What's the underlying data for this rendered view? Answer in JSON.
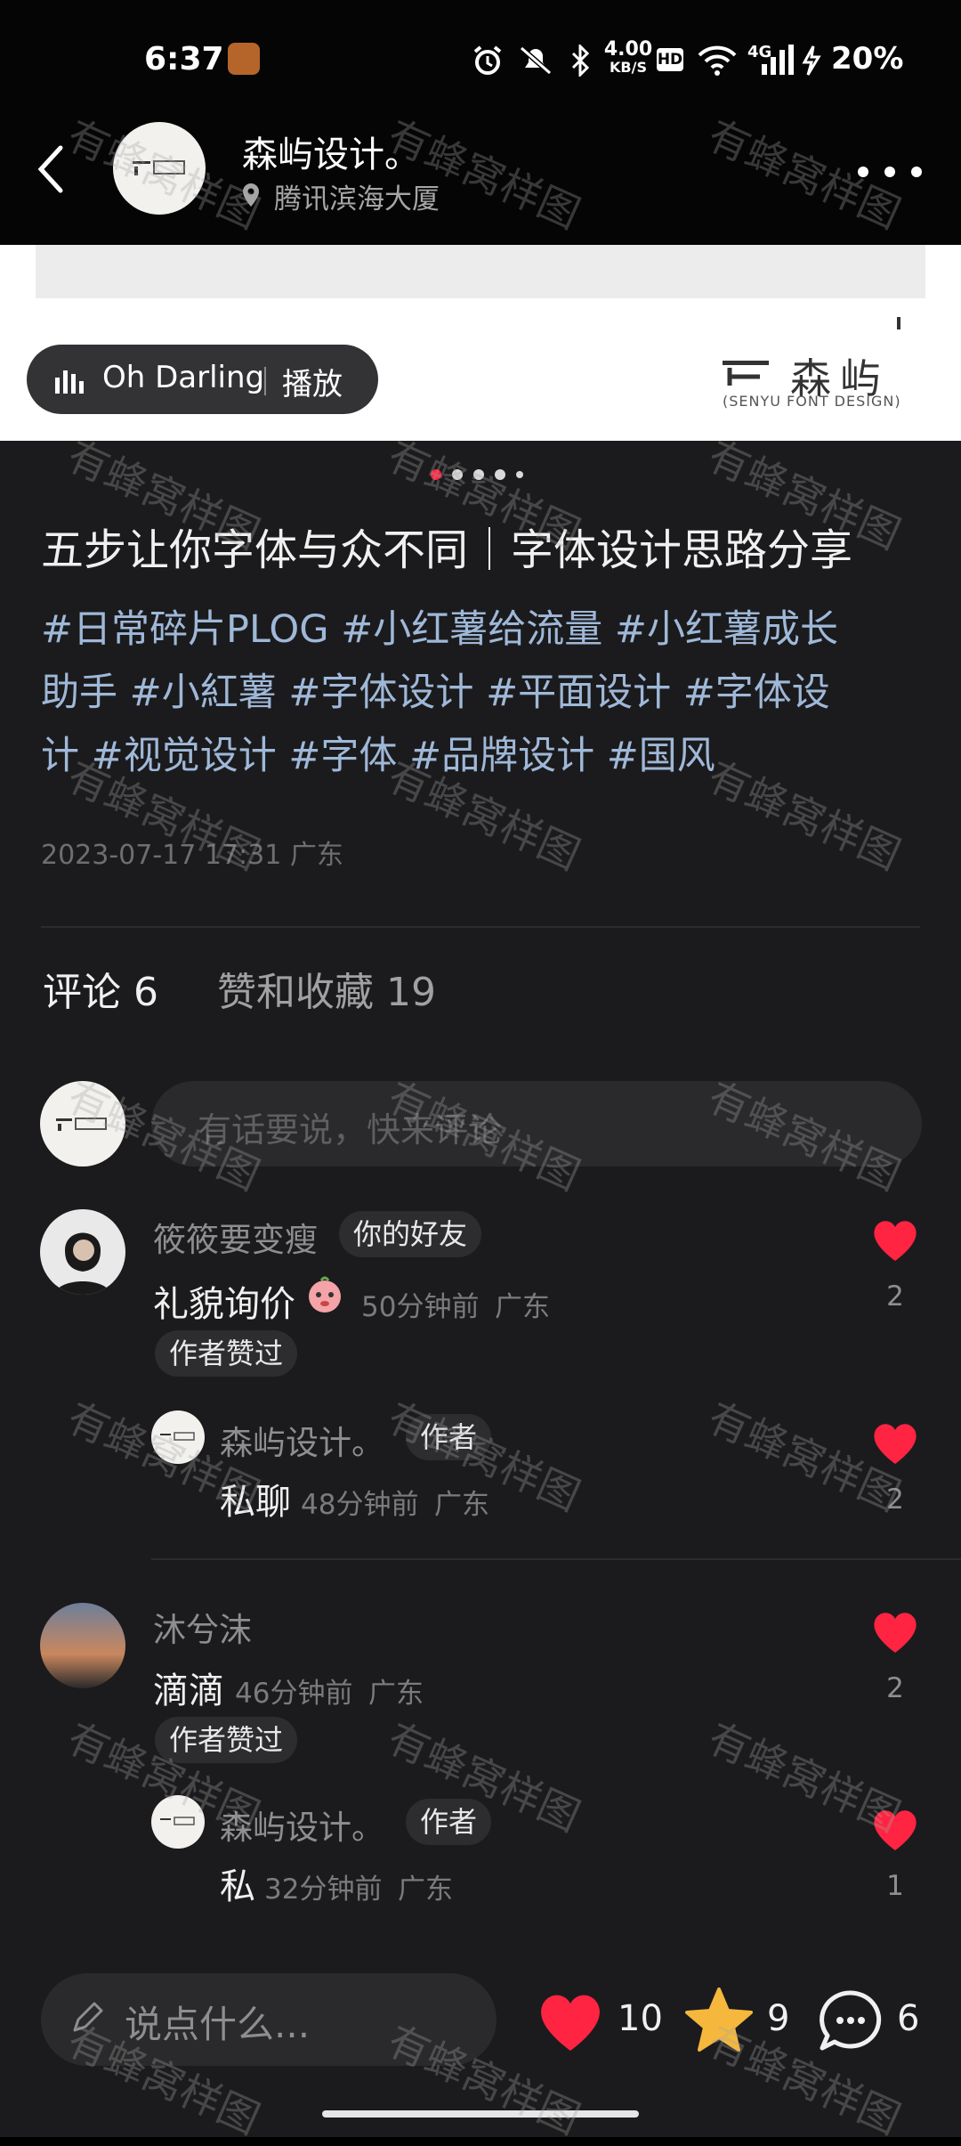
{
  "status_bar": {
    "time": "6:37",
    "speed": "4.00",
    "speed_unit": "KB/S",
    "hd": "HD",
    "net": "4G",
    "battery": "20%"
  },
  "header": {
    "author": "森屿设计。",
    "location": "腾讯滨海大厦"
  },
  "image": {
    "music_title": "Oh Darling",
    "music_action": "播放",
    "brand_cn": "森屿",
    "brand_en": "(SENYU FONT DESIGN)"
  },
  "post": {
    "title": "五步让你字体与众不同｜字体设计思路分享",
    "tags_line1": "#日常碎片PLOG #小红薯给流量 #小红薯成长",
    "tags_line2": "助手 #小紅薯 #字体设计 #平面设计 #字体设",
    "tags_line3": "计 #视觉设计 #字体 #品牌设计 #国风",
    "date": "2023-07-17 17:31 广东"
  },
  "tabs": {
    "comments": "评论 6",
    "likes": "赞和收藏 19"
  },
  "comment_input": {
    "placeholder": "有话要说，快来评论"
  },
  "comments": [
    {
      "name": "筱筱要变瘦",
      "badge": "你的好友",
      "text": "礼貌询价",
      "time": "50分钟前",
      "region": "广东",
      "tag": "作者赞过",
      "likes": "2",
      "reply": {
        "name": "森屿设计。",
        "badge": "作者",
        "text": "私聊",
        "time": "48分钟前",
        "region": "广东",
        "likes": "2"
      }
    },
    {
      "name": "沐兮沫",
      "text": "滴滴",
      "time": "46分钟前",
      "region": "广东",
      "tag": "作者赞过",
      "likes": "2",
      "reply": {
        "name": "森屿设计。",
        "badge": "作者",
        "text": "私",
        "time": "32分钟前",
        "region": "广东",
        "likes": "1"
      }
    }
  ],
  "bottom_bar": {
    "placeholder": "说点什么...",
    "likes": "10",
    "stars": "9",
    "comments": "6"
  },
  "watermark": "有蜂窝样图",
  "colors": {
    "heart": "#ff2442",
    "star": "#f5b83d",
    "tag_link": "#9fb8d8",
    "content_bg": "#1b1b1d"
  }
}
